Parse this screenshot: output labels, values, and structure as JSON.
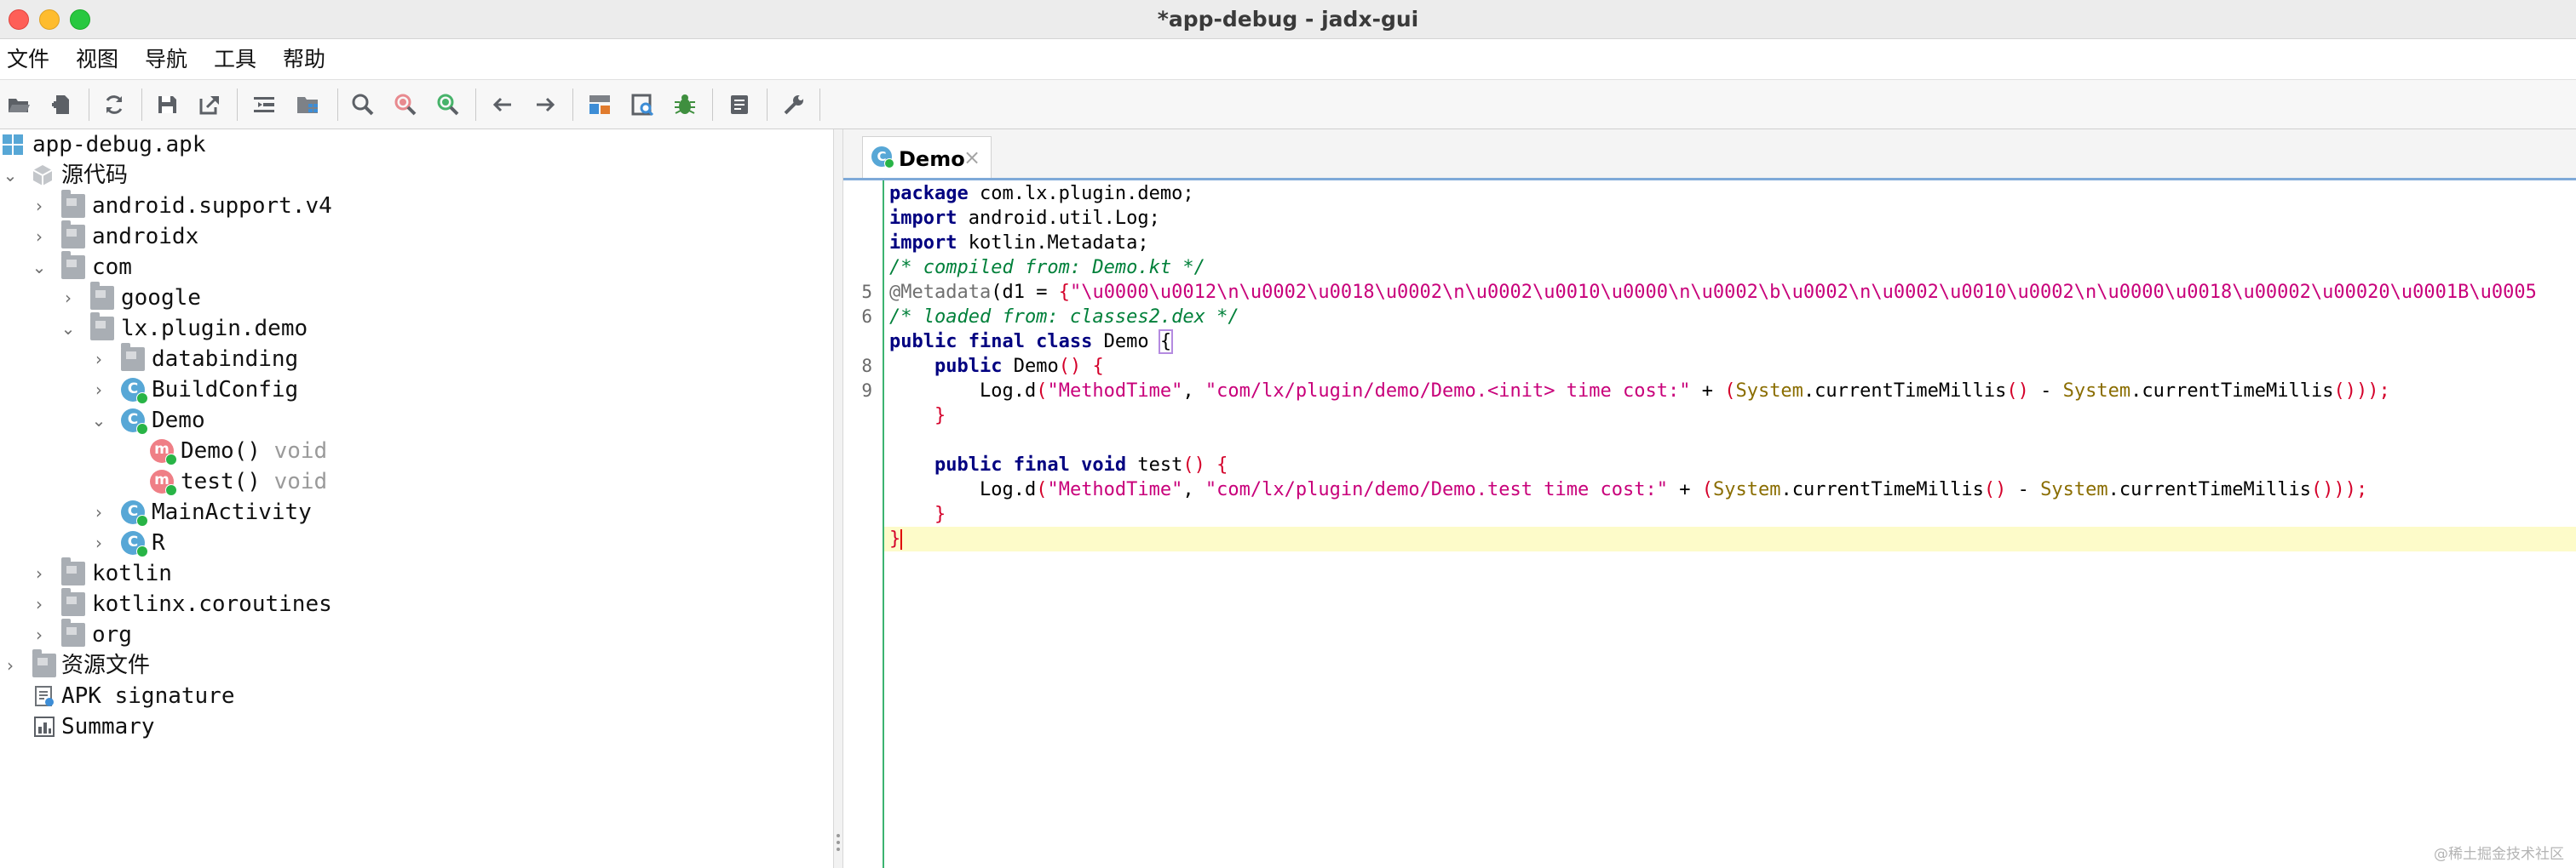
{
  "window": {
    "title": "*app-debug - jadx-gui"
  },
  "menu": [
    "文件",
    "视图",
    "导航",
    "工具",
    "帮助"
  ],
  "toolbar": {
    "buttons": [
      {
        "name": "open-file-icon"
      },
      {
        "name": "add-files-icon"
      },
      {
        "name": "sync-icon"
      },
      {
        "name": "save-all-icon"
      },
      {
        "name": "export-icon"
      },
      {
        "name": "sync-tree-icon"
      },
      {
        "name": "flatten-packages-icon"
      },
      {
        "name": "search-icon"
      },
      {
        "name": "class-search-icon"
      },
      {
        "name": "usage-search-icon"
      },
      {
        "name": "back-icon"
      },
      {
        "name": "forward-icon"
      },
      {
        "name": "deobfuscation-icon"
      },
      {
        "name": "quark-icon"
      },
      {
        "name": "debugger-icon"
      },
      {
        "name": "log-viewer-icon"
      },
      {
        "name": "preferences-icon"
      }
    ]
  },
  "tree": {
    "root": "app-debug.apk",
    "items": [
      {
        "label": "源代码",
        "type": ""
      },
      {
        "label": "android.support.v4",
        "type": ""
      },
      {
        "label": "androidx",
        "type": ""
      },
      {
        "label": "com",
        "type": ""
      },
      {
        "label": "google",
        "type": ""
      },
      {
        "label": "lx.plugin.demo",
        "type": ""
      },
      {
        "label": "databinding",
        "type": ""
      },
      {
        "label": "BuildConfig",
        "type": ""
      },
      {
        "label": "Demo",
        "type": ""
      },
      {
        "label": "Demo()",
        "type": "void"
      },
      {
        "label": "test()",
        "type": "void"
      },
      {
        "label": "MainActivity",
        "type": ""
      },
      {
        "label": "R",
        "type": ""
      },
      {
        "label": "kotlin",
        "type": ""
      },
      {
        "label": "kotlinx.coroutines",
        "type": ""
      },
      {
        "label": "org",
        "type": ""
      },
      {
        "label": "资源文件",
        "type": ""
      },
      {
        "label": "APK signature",
        "type": ""
      },
      {
        "label": "Summary",
        "type": ""
      }
    ]
  },
  "editor": {
    "tab": {
      "label": "Demo",
      "close": "×",
      "icon_letter": "C"
    },
    "line_numbers": [
      "5",
      "6",
      "8",
      "9"
    ],
    "code": {
      "l1_kw": "package",
      "l1_rest": " com.lx.plugin.demo;",
      "l3_kw": "import",
      "l3_rest": " android.util.Log;",
      "l4_kw": "import",
      "l4_rest": " kotlin.Metadata;",
      "l6_cmt": "/* compiled from: Demo.kt */",
      "l7_ann": "@Metadata",
      "l7_a": "(d1 = ",
      "l7_b": "{",
      "l7_str": "\"\\u0000\\u0012\\n\\u0002\\u0018\\u0002\\n\\u0002\\u0010\\u0000\\n\\u0002\\b\\u0002\\n\\u0002\\u0010\\u0002\\n\\u0000\\u0018\\u00002\\u00020\\u0001B\\u0005",
      "l8_cmt": "/* loaded from: classes2.dex */",
      "l9_kw": "public final class",
      "l9_name": " Demo ",
      "l9_brace": "{",
      "l10_kw": "public",
      "l10_name": " Demo",
      "l10_paren": "()",
      "l10_brace": " {",
      "l11_a": "Log.d",
      "l11_p1": "(",
      "l11_s1": "\"MethodTime\"",
      "l11_c": ", ",
      "l11_s2": "\"com/lx/plugin/demo/Demo.<init> time cost:\"",
      "l11_plus": " + ",
      "l11_p2": "(",
      "l11_sys1": "System",
      "l11_m1": ".currentTimeMillis",
      "l11_e1": "()",
      "l11_minus": " - ",
      "l11_sys2": "System",
      "l11_m2": ".currentTimeMillis",
      "l11_end": "()));",
      "l12": "}",
      "l14_kw": "public final void",
      "l14_name": " test",
      "l14_paren": "()",
      "l14_brace": " {",
      "l15_a": "Log.d",
      "l15_p1": "(",
      "l15_s1": "\"MethodTime\"",
      "l15_c": ", ",
      "l15_s2": "\"com/lx/plugin/demo/Demo.test time cost:\"",
      "l15_plus": " + ",
      "l15_p2": "(",
      "l15_sys1": "System",
      "l15_m1": ".currentTimeMillis",
      "l15_e1": "()",
      "l15_minus": " - ",
      "l15_sys2": "System",
      "l15_m2": ".currentTimeMillis",
      "l15_end": "()));",
      "l16": "}",
      "l17": "}"
    }
  },
  "watermark": "@稀土掘金技术社区",
  "colors": {
    "keyword": "#000080",
    "string": "#c8007a",
    "comment": "#00803a",
    "class": "#8a6d00",
    "paren": "#d4002a",
    "current_line": "#fdfbc9",
    "gutter_line": "#3cb371"
  }
}
